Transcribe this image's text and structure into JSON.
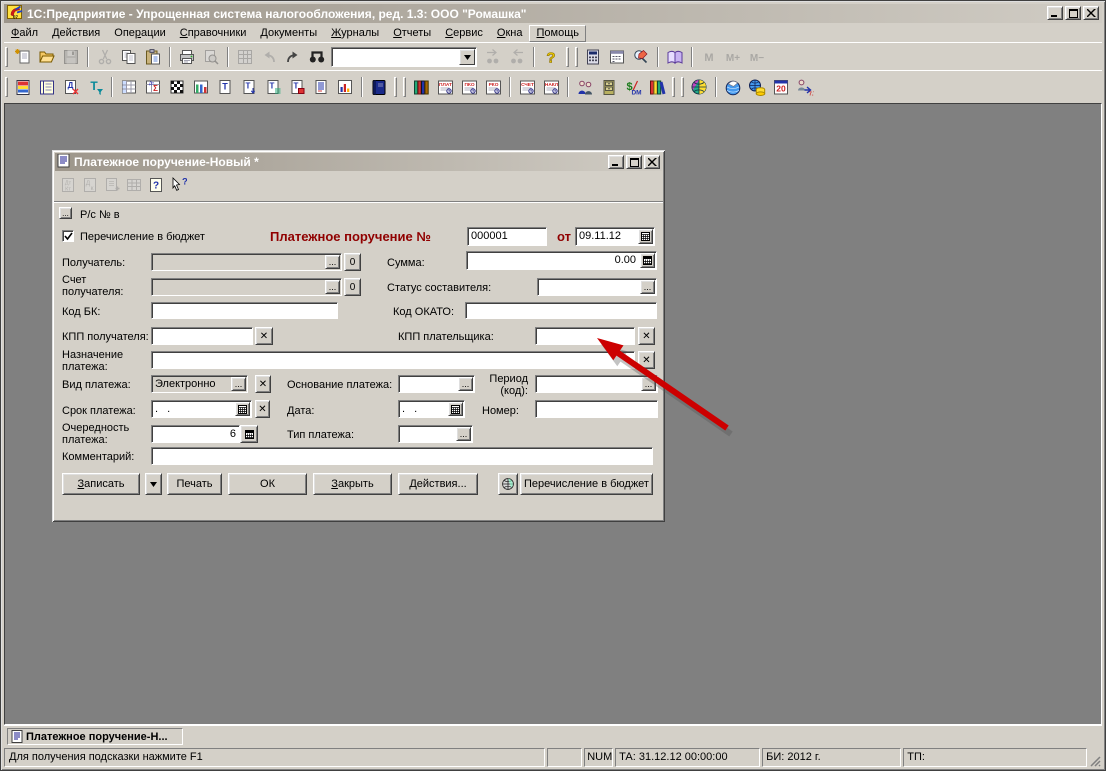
{
  "window": {
    "title": "1С:Предприятие - Упрощенная система налогообложения, ред. 1.3: ООО \"Ромашка\"",
    "controls": [
      "minimize",
      "maximize",
      "close"
    ]
  },
  "menu": {
    "items": [
      {
        "label": "Файл",
        "u": 0
      },
      {
        "label": "Действия",
        "u": 0
      },
      {
        "label": "Операции",
        "u": 3
      },
      {
        "label": "Справочники",
        "u": 0
      },
      {
        "label": "Документы",
        "u": 0
      },
      {
        "label": "Журналы",
        "u": 0
      },
      {
        "label": "Отчеты",
        "u": 0
      },
      {
        "label": "Сервис",
        "u": 0
      },
      {
        "label": "Окна",
        "u": 0
      },
      {
        "label": "Помощь",
        "u": 0,
        "boxed": true
      }
    ]
  },
  "toolbar1": [
    {
      "type": "grip"
    },
    {
      "type": "icon",
      "name": "new-document-icon"
    },
    {
      "type": "icon",
      "name": "open-icon"
    },
    {
      "type": "icon",
      "name": "save-icon",
      "disabled": true
    },
    {
      "type": "sep"
    },
    {
      "type": "icon",
      "name": "cut-icon",
      "disabled": true
    },
    {
      "type": "icon",
      "name": "copy-icon"
    },
    {
      "type": "icon",
      "name": "paste-icon"
    },
    {
      "type": "sep"
    },
    {
      "type": "icon",
      "name": "print-icon"
    },
    {
      "type": "icon",
      "name": "print-preview-icon",
      "disabled": true
    },
    {
      "type": "sep"
    },
    {
      "type": "icon",
      "name": "table-view-icon",
      "disabled": true
    },
    {
      "type": "icon",
      "name": "undo-icon",
      "disabled": true
    },
    {
      "type": "icon",
      "name": "redo-icon"
    },
    {
      "type": "icon",
      "name": "find-icon"
    },
    {
      "type": "combo"
    },
    {
      "type": "icon",
      "name": "find-next-icon",
      "disabled": true
    },
    {
      "type": "icon",
      "name": "find-prev-icon",
      "disabled": true
    },
    {
      "type": "sep"
    },
    {
      "type": "icon",
      "name": "help-icon"
    },
    {
      "type": "grip"
    },
    {
      "type": "grip2"
    },
    {
      "type": "icon",
      "name": "calculator-icon"
    },
    {
      "type": "icon",
      "name": "calendar-icon"
    },
    {
      "type": "icon",
      "name": "formula-calc-icon"
    },
    {
      "type": "sep"
    },
    {
      "type": "icon",
      "name": "methodology-book-icon"
    },
    {
      "type": "sep"
    },
    {
      "type": "icon",
      "name": "memory-recall-icon",
      "disabled": true
    },
    {
      "type": "icon",
      "name": "memory-plus-icon",
      "disabled": true
    },
    {
      "type": "icon",
      "name": "memory-minus-icon",
      "disabled": true
    }
  ],
  "toolbar2": [
    {
      "type": "grip"
    },
    {
      "type": "icon",
      "name": "guide-book-icon"
    },
    {
      "type": "icon",
      "name": "journal-icon"
    },
    {
      "type": "icon",
      "name": "doc-marked-icon"
    },
    {
      "type": "icon",
      "name": "t-filter-icon"
    },
    {
      "type": "sep"
    },
    {
      "type": "icon",
      "name": "table-data-icon"
    },
    {
      "type": "icon",
      "name": "table-sum-icon"
    },
    {
      "type": "icon",
      "name": "checkerboard-icon"
    },
    {
      "type": "icon",
      "name": "table-cols-icon"
    },
    {
      "type": "icon",
      "name": "doc-t-icon"
    },
    {
      "type": "icon",
      "name": "doc-t-down-icon"
    },
    {
      "type": "icon",
      "name": "doc-t-list-icon"
    },
    {
      "type": "icon",
      "name": "doc-t-red-icon"
    },
    {
      "type": "icon",
      "name": "doc-lines-icon"
    },
    {
      "type": "icon",
      "name": "chart-icon"
    },
    {
      "type": "sep"
    },
    {
      "type": "icon",
      "name": "blue-book-icon"
    },
    {
      "type": "grip"
    },
    {
      "type": "grip2"
    },
    {
      "type": "icon",
      "name": "books-stack-icon"
    },
    {
      "type": "icon",
      "name": "plat-doc-icon",
      "label": "ПЛАТ"
    },
    {
      "type": "icon",
      "name": "pko-doc-icon",
      "label": "ПКО"
    },
    {
      "type": "icon",
      "name": "rko-doc-icon",
      "label": "РКО"
    },
    {
      "type": "sep"
    },
    {
      "type": "icon",
      "name": "schet-doc-icon",
      "label": "СЧЕТ"
    },
    {
      "type": "icon",
      "name": "nakl-doc-icon",
      "label": "НАКЛ"
    },
    {
      "type": "sep"
    },
    {
      "type": "icon",
      "name": "partners-icon"
    },
    {
      "type": "icon",
      "name": "cabinet-icon"
    },
    {
      "type": "icon",
      "name": "currency-icon"
    },
    {
      "type": "icon",
      "name": "books-row-icon"
    },
    {
      "type": "grip"
    },
    {
      "type": "grip2"
    },
    {
      "type": "icon",
      "name": "globe-icon"
    },
    {
      "type": "sep"
    },
    {
      "type": "icon",
      "name": "dove-globe-icon"
    },
    {
      "type": "icon",
      "name": "db-globe-icon"
    },
    {
      "type": "icon",
      "name": "calendar-20-icon"
    },
    {
      "type": "icon",
      "name": "person-transfer-icon"
    }
  ],
  "doc_toolbar": [
    {
      "type": "icon",
      "name": "dtkt-icon",
      "disabled": true
    },
    {
      "type": "icon",
      "name": "dtkt-k-icon",
      "disabled": true
    },
    {
      "type": "icon",
      "name": "doc-plus-icon",
      "disabled": true
    },
    {
      "type": "icon",
      "name": "grid-icon",
      "disabled": true
    },
    {
      "type": "icon",
      "name": "help-doc-icon"
    },
    {
      "type": "icon",
      "name": "context-help-icon"
    }
  ],
  "form": {
    "title": "Платежное поручение-Новый *",
    "rs_label": "Р/с №  в",
    "budget_checkbox_label": "Перечисление в бюджет",
    "doc_title": "Платежное поручение №",
    "number_value": "000001",
    "ot_label": "от",
    "date_value": "09.11.12",
    "recipient_label": "Получатель:",
    "recipient_count": "0",
    "sum_label": "Сумма:",
    "sum_value": "0.00",
    "account_label": "Счет получателя:",
    "account_count": "0",
    "status_label": "Статус составителя:",
    "kbk_label": "Код БК:",
    "okato_label": "Код ОКАТО:",
    "kpp_recv_label": "КПП получателя:",
    "kpp_payer_label": "КПП плательщика:",
    "purpose_label": "Назначение платежа:",
    "paytype_label": "Вид платежа:",
    "paytype_value": "Электронно",
    "basis_label": "Основание платежа:",
    "period_label": "Период (код):",
    "term_label": "Срок платежа:",
    "term_value": ". .",
    "date2_label": "Дата:",
    "date2_value": ". .",
    "number2_label": "Номер:",
    "order_label": "Очередность платежа:",
    "order_value": "6",
    "typepay_label": "Тип платежа:",
    "comment_label": "Комментарий:",
    "buttons": {
      "save": "Записать",
      "print": "Печать",
      "ok": "ОК",
      "close": "Закрыть",
      "actions": "Действия...",
      "budget": "Перечисление в бюджет"
    }
  },
  "taskbar": {
    "tab": "Платежное поручение-Н..."
  },
  "statusbar": {
    "help": "Для получения подсказки нажмите F1",
    "num": "NUM",
    "ta": "ТА: 31.12.12  00:00:00",
    "bi": "БИ: 2012 г.",
    "tp": "ТП:"
  }
}
